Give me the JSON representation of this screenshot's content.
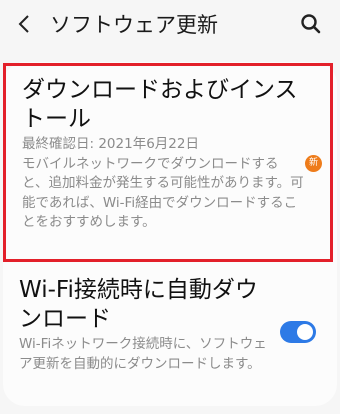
{
  "header": {
    "title": "ソフトウェア更新",
    "back_icon": "back-arrow-icon",
    "search_icon": "search-icon"
  },
  "items": [
    {
      "title": "ダウンロードおよびインストール",
      "description": "最終確認日: 2021年6月22日\nモバイルネットワークでダウンロードすると、追加料金が発生する可能性があります。可能であれば、Wi-Fi経由でダウンロードすることをおすすめします。",
      "badge": "新",
      "badge_color": "#ee7c1b",
      "highlight_color": "#e3202a"
    },
    {
      "title": "Wi-Fi接続時に自動ダウンロード",
      "description": "Wi-Fiネットワーク接続時に、ソフトウェア更新を自動的にダウンロードします。",
      "toggle": true,
      "toggle_color": "#2d7ae6"
    }
  ]
}
